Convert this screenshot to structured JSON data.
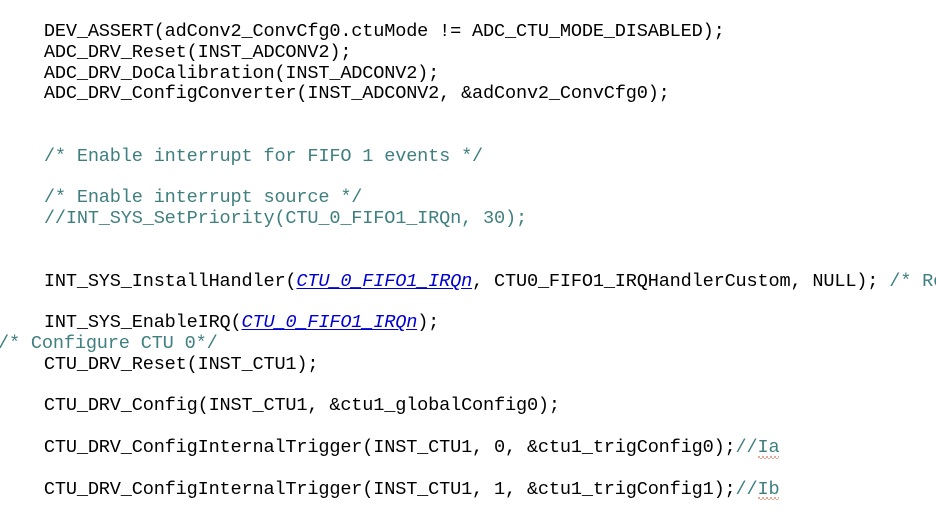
{
  "editor": {
    "language": "C",
    "background_color": "#ffffff",
    "text_color": "#000000",
    "comment_color": "#3f7f7f",
    "enum_color": "#0000d0",
    "spellcheck_underline_color": "#d4502a",
    "indent": "    "
  },
  "lines": [
    {
      "id": "line-dev-assert",
      "segments": [
        {
          "kind": "plain",
          "text": "    DEV_ASSERT(adConv2_ConvCfg0.ctuMode != ADC_CTU_MODE_DISABLED);"
        }
      ]
    },
    {
      "id": "line-adc-reset",
      "segments": [
        {
          "kind": "plain",
          "text": "    ADC_DRV_Reset(INST_ADCONV2);"
        }
      ]
    },
    {
      "id": "line-adc-docalibration",
      "segments": [
        {
          "kind": "plain",
          "text": "    ADC_DRV_DoCalibration(INST_ADCONV2);"
        }
      ]
    },
    {
      "id": "line-adc-configconverter",
      "segments": [
        {
          "kind": "plain",
          "text": "    ADC_DRV_ConfigConverter(INST_ADCONV2, &adConv2_ConvCfg0);"
        }
      ]
    },
    {
      "id": "line-blank-1",
      "segments": [
        {
          "kind": "plain",
          "text": ""
        }
      ]
    },
    {
      "id": "line-blank-2",
      "segments": [
        {
          "kind": "plain",
          "text": ""
        }
      ]
    },
    {
      "id": "line-comment-enable-fifo",
      "segments": [
        {
          "kind": "comment",
          "text": "    /* Enable interrupt for FIFO 1 events */"
        }
      ]
    },
    {
      "id": "line-blank-3",
      "segments": [
        {
          "kind": "plain",
          "text": ""
        }
      ]
    },
    {
      "id": "line-comment-enable-source",
      "segments": [
        {
          "kind": "comment",
          "text": "    /* Enable interrupt source */"
        }
      ]
    },
    {
      "id": "line-commented-setpriority",
      "segments": [
        {
          "kind": "comment",
          "text": "    //INT_SYS_SetPriority(CTU_0_FIFO1_IRQn, 30);"
        }
      ]
    },
    {
      "id": "line-blank-4",
      "segments": [
        {
          "kind": "plain",
          "text": ""
        }
      ]
    },
    {
      "id": "line-blank-5",
      "segments": [
        {
          "kind": "plain",
          "text": ""
        }
      ]
    },
    {
      "id": "line-install-handler",
      "segments": [
        {
          "kind": "plain",
          "text": "    INT_SYS_InstallHandler("
        },
        {
          "kind": "enum",
          "text": "CTU_0_FIFO1_IRQn"
        },
        {
          "kind": "plain",
          "text": ", CTU0_FIFO1_IRQHandlerCustom, NULL); "
        },
        {
          "kind": "comment",
          "text": "/* Re"
        }
      ]
    },
    {
      "id": "line-blank-6",
      "segments": [
        {
          "kind": "plain",
          "text": ""
        }
      ]
    },
    {
      "id": "line-enable-irq",
      "segments": [
        {
          "kind": "plain",
          "text": "    INT_SYS_EnableIRQ("
        },
        {
          "kind": "enum",
          "text": "CTU_0_FIFO1_IRQn"
        },
        {
          "kind": "plain",
          "text": ");"
        }
      ]
    },
    {
      "id": "line-comment-configure-ctu0",
      "flush_left": true,
      "segments": [
        {
          "kind": "comment",
          "text": "/* Configure CTU 0*/"
        }
      ]
    },
    {
      "id": "line-ctu-reset",
      "segments": [
        {
          "kind": "plain",
          "text": "    CTU_DRV_Reset(INST_CTU1);"
        }
      ]
    },
    {
      "id": "line-blank-7",
      "segments": [
        {
          "kind": "plain",
          "text": ""
        }
      ]
    },
    {
      "id": "line-ctu-config",
      "segments": [
        {
          "kind": "plain",
          "text": "    CTU_DRV_Config(INST_CTU1, &ctu1_globalConfig0);"
        }
      ]
    },
    {
      "id": "line-blank-8",
      "segments": [
        {
          "kind": "plain",
          "text": ""
        }
      ]
    },
    {
      "id": "line-ctu-trig0",
      "segments": [
        {
          "kind": "plain",
          "text": "    CTU_DRV_ConfigInternalTrigger(INST_CTU1, 0, &ctu1_trigConfig0);"
        },
        {
          "kind": "comment",
          "text": "//"
        },
        {
          "kind": "misspelled",
          "text": "Ia"
        }
      ]
    },
    {
      "id": "line-blank-9",
      "segments": [
        {
          "kind": "plain",
          "text": ""
        }
      ]
    },
    {
      "id": "line-ctu-trig1",
      "segments": [
        {
          "kind": "plain",
          "text": "    CTU_DRV_ConfigInternalTrigger(INST_CTU1, 1, &ctu1_trigConfig1);"
        },
        {
          "kind": "comment",
          "text": "//"
        },
        {
          "kind": "misspelled",
          "text": "Ib"
        }
      ]
    }
  ]
}
